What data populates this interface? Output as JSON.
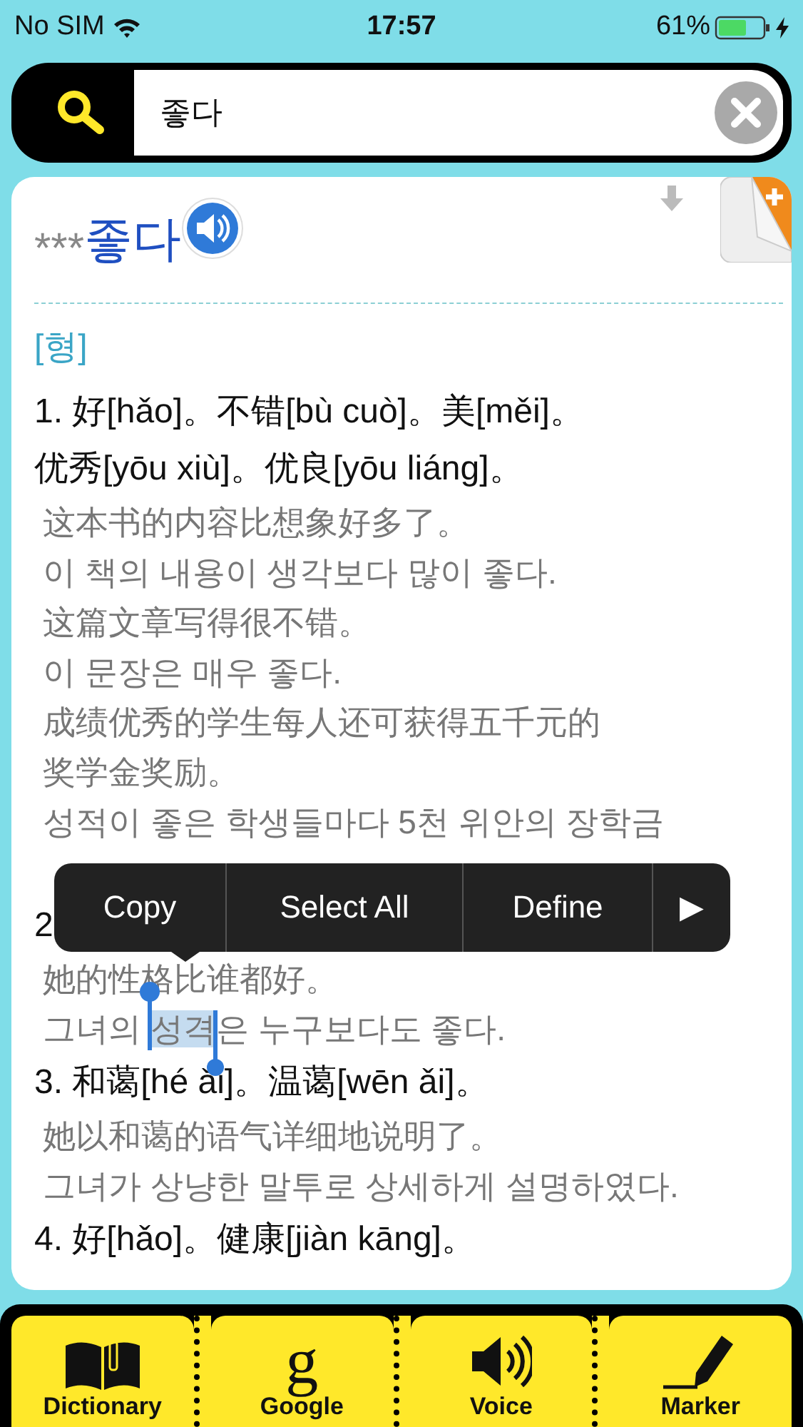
{
  "status_bar": {
    "carrier": "No SIM",
    "time": "17:57",
    "battery": "61%"
  },
  "search": {
    "value": "좋다"
  },
  "entry": {
    "stars": "***",
    "headword": "좋다",
    "pos": "[형]",
    "lines": [
      {
        "kind": "sense",
        "text": "1. 好[hǎo]。不错[bù cuò]。美[měi]。"
      },
      {
        "kind": "sense",
        "text": "优秀[yōu xiù]。优良[yōu liáng]。"
      },
      {
        "kind": "example",
        "text": "这本书的内容比想象好多了。"
      },
      {
        "kind": "example",
        "text": "이 책의 내용이 생각보다 많이 좋다."
      },
      {
        "kind": "example",
        "text": "这篇文章写得很不错。"
      },
      {
        "kind": "example",
        "text": "이 문장은 매우 좋다."
      },
      {
        "kind": "example",
        "text": "成绩优秀的学生每人还可获得五千元的"
      },
      {
        "kind": "example",
        "text": "奖学金奖励。"
      },
      {
        "kind": "example",
        "text": "성적이 좋은 학생들마다 5천 위안의 장학금"
      },
      {
        "kind": "gap"
      },
      {
        "kind": "sense",
        "text": "2"
      },
      {
        "kind": "example",
        "text": "她的性格比谁都好。"
      },
      {
        "kind": "example",
        "parts": [
          {
            "text": "그녀의 ",
            "selected": false
          },
          {
            "text": "성격",
            "selected": true
          },
          {
            "text": "은 누구보다도 좋다.",
            "selected": false
          }
        ]
      },
      {
        "kind": "sense",
        "text": "3. 和蔼[hé ǎi]。温蔼[wēn ǎi]。"
      },
      {
        "kind": "example",
        "text": "她以和蔼的语气详细地说明了。"
      },
      {
        "kind": "example",
        "text": "그녀가 상냥한 말투로 상세하게 설명하였다."
      },
      {
        "kind": "sense",
        "text": "4. 好[hǎo]。健康[jiàn kāng]。"
      }
    ]
  },
  "context_menu": [
    "Copy",
    "Select All",
    "Define",
    "▶"
  ],
  "toolbar": [
    {
      "label": "Dictionary"
    },
    {
      "label": "Google",
      "glyph": "g"
    },
    {
      "label": "Voice"
    },
    {
      "label": "Marker"
    }
  ]
}
